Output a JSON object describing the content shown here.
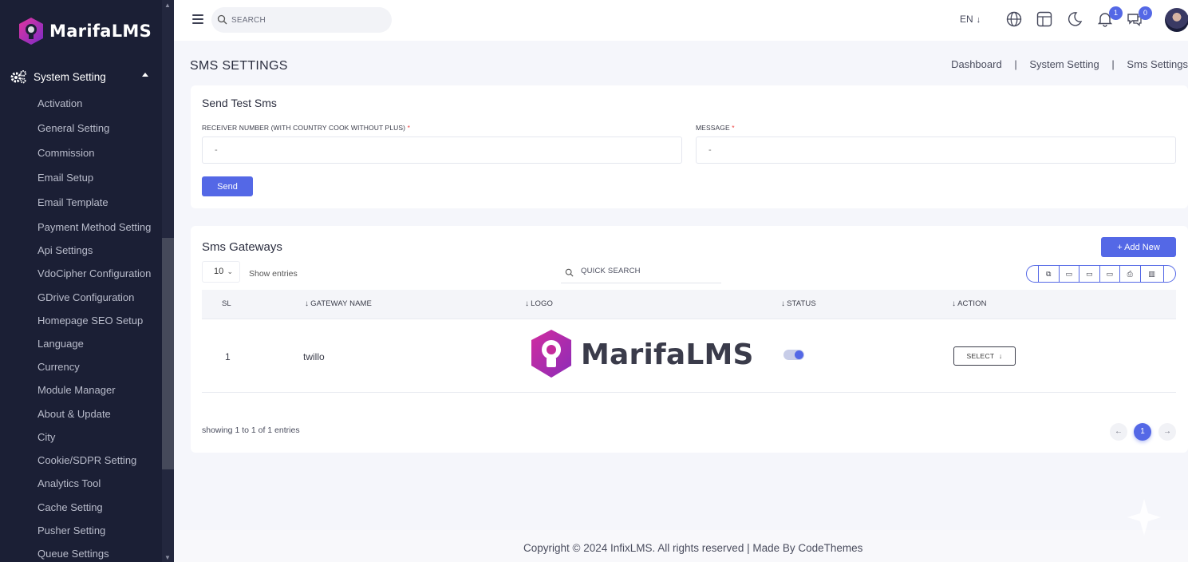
{
  "brand": {
    "name": "MarifaLMS"
  },
  "sidebar": {
    "parent_label": "System Setting",
    "items": [
      {
        "label": "Activation"
      },
      {
        "label": "General Setting"
      },
      {
        "label": "Commission"
      },
      {
        "label": "Email Setup"
      },
      {
        "label": "Email Template"
      },
      {
        "label": "Payment Method Setting"
      },
      {
        "label": "Api Settings"
      },
      {
        "label": "VdoCipher Configuration"
      },
      {
        "label": "GDrive Configuration"
      },
      {
        "label": "Homepage SEO Setup"
      },
      {
        "label": "Language"
      },
      {
        "label": "Currency"
      },
      {
        "label": "Module Manager"
      },
      {
        "label": "About & Update"
      },
      {
        "label": "City"
      },
      {
        "label": "Cookie/SDPR Setting"
      },
      {
        "label": "Analytics Tool"
      },
      {
        "label": "Cache Setting"
      },
      {
        "label": "Pusher Setting"
      },
      {
        "label": "Queue Settings"
      }
    ]
  },
  "header": {
    "search_placeholder": "SEARCH",
    "language": "EN",
    "notification_count": "1",
    "message_count": "0",
    "icons": [
      "menu-icon",
      "search-icon",
      "globe-icon",
      "layout-icon",
      "moon-icon",
      "bell-icon",
      "chat-icon"
    ]
  },
  "page": {
    "title": "SMS SETTINGS",
    "breadcrumb": [
      "Dashboard",
      "System Setting",
      "Sms Settings"
    ],
    "breadcrumb_sep": "|"
  },
  "test_sms": {
    "title": "Send Test Sms",
    "receiver_label": "RECEIVER NUMBER (WITH COUNTRY COOK WITHOUT PLUS)",
    "receiver_placeholder": "-",
    "message_label": "MESSAGE",
    "message_placeholder": "-",
    "required_mark": "*",
    "send_label": "Send"
  },
  "gateways": {
    "title": "Sms Gateways",
    "add_new_label": "Add New",
    "add_new_prefix": "+",
    "page_length": "10",
    "show_entries": "Show entries",
    "quick_search_placeholder": "QUICK SEARCH",
    "export_icons": [
      "copy-icon",
      "csv-icon",
      "excel-icon",
      "pdf-icon",
      "print-icon",
      "columns-icon"
    ],
    "columns": [
      "SL",
      "GATEWAY NAME",
      "LOGO",
      "STATUS",
      "ACTION"
    ],
    "rows": [
      {
        "sl": "1",
        "name": "twillo",
        "logo_text": "MarifaLMS",
        "status": true,
        "action_label": "SELECT"
      }
    ],
    "showing": "showing 1 to 1 of 1 entries",
    "pager": {
      "prev": "←",
      "current": "1",
      "next": "→"
    }
  },
  "footer": {
    "text": "Copyright © 2024 InfixLMS. All rights reserved | Made By CodeThemes"
  },
  "colors": {
    "accent": "#5468e6",
    "sidebar_bg": "#1b1f35",
    "page_bg": "#f5f6fb",
    "logo_pink": "#c5289a"
  }
}
